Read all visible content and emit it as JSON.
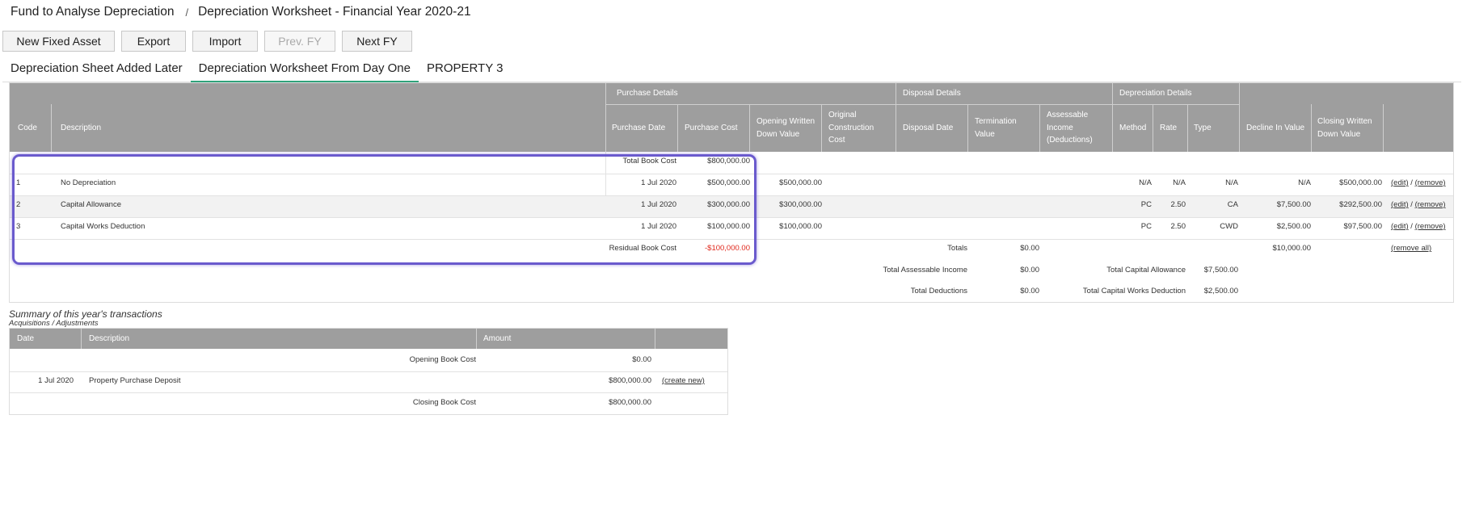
{
  "breadcrumb": {
    "parent": "Fund to Analyse Depreciation",
    "separator": "/",
    "current": "Depreciation Worksheet - Financial Year 2020-21"
  },
  "toolbar": {
    "new_fixed_asset": "New Fixed Asset",
    "export": "Export",
    "import": "Import",
    "prev_fy": "Prev. FY",
    "next_fy": "Next FY"
  },
  "tabs": [
    {
      "label": "Depreciation Sheet Added Later",
      "active": false
    },
    {
      "label": "Depreciation Worksheet From Day One",
      "active": true
    },
    {
      "label": "PROPERTY 3",
      "active": false
    }
  ],
  "table": {
    "groups": {
      "purchase": "Purchase Details",
      "disposal": "Disposal Details",
      "depreciation": "Depreciation Details"
    },
    "columns": {
      "code": "Code",
      "description": "Description",
      "purchase_date": "Purchase Date",
      "purchase_cost": "Purchase Cost",
      "opening_wdv": [
        "Opening Written",
        "Down Value"
      ],
      "original_cost": [
        "Original",
        "Construction",
        "Cost"
      ],
      "disposal_date": "Disposal Date",
      "termination_value": [
        "Termination",
        "Value"
      ],
      "assessable_income": [
        "Assessable",
        "Income",
        "(Deductions)"
      ],
      "method": "Method",
      "rate": "Rate",
      "type": "Type",
      "decline": "Decline In Value",
      "closing_wdv": [
        "Closing Written",
        "Down Value"
      ]
    },
    "total_book_cost_label": "Total Book Cost",
    "total_book_cost": "$800,000.00",
    "rows": [
      {
        "code": "1",
        "description": "No Depreciation",
        "purchase_date": "1 Jul 2020",
        "purchase_cost": "$500,000.00",
        "opening_wdv": "$500,000.00",
        "method": "N/A",
        "rate": "N/A",
        "type": "N/A",
        "decline": "N/A",
        "closing_wdv": "$500,000.00",
        "edit": "(edit)",
        "slash": "/",
        "remove": "(remove)"
      },
      {
        "code": "2",
        "description": "Capital Allowance",
        "purchase_date": "1 Jul 2020",
        "purchase_cost": "$300,000.00",
        "opening_wdv": "$300,000.00",
        "method": "PC",
        "rate": "2.50",
        "type": "CA",
        "decline": "$7,500.00",
        "closing_wdv": "$292,500.00",
        "edit": "(edit)",
        "slash": "/",
        "remove": "(remove)"
      },
      {
        "code": "3",
        "description": "Capital Works Deduction",
        "purchase_date": "1 Jul 2020",
        "purchase_cost": "$100,000.00",
        "opening_wdv": "$100,000.00",
        "method": "PC",
        "rate": "2.50",
        "type": "CWD",
        "decline": "$2,500.00",
        "closing_wdv": "$97,500.00",
        "edit": "(edit)",
        "slash": "/",
        "remove": "(remove)"
      }
    ],
    "residual_label": "Residual Book Cost",
    "residual_value": "-$100,000.00",
    "totals_label": "Totals",
    "totals_termination": "$0.00",
    "totals_decline": "$10,000.00",
    "remove_all": "(remove all)",
    "total_assessable_label": "Total Assessable Income",
    "total_assessable": "$0.00",
    "total_capital_allowance_label": "Total Capital Allowance",
    "total_capital_allowance": "$7,500.00",
    "total_deductions_label": "Total Deductions",
    "total_deductions": "$0.00",
    "total_cwd_label": "Total Capital Works Deduction",
    "total_cwd": "$2,500.00"
  },
  "summary": {
    "title": "Summary of this year's transactions",
    "subtitle": "Acquisitions / Adjustments",
    "columns": {
      "date": "Date",
      "description": "Description",
      "amount": "Amount"
    },
    "opening_label": "Opening Book Cost",
    "opening_value": "$0.00",
    "row": {
      "date": "1 Jul 2020",
      "description": "Property Purchase Deposit",
      "amount": "$800,000.00",
      "action": "(create new)"
    },
    "closing_label": "Closing Book Cost",
    "closing_value": "$800,000.00"
  },
  "colors": {
    "header_bg": "#9e9e9e",
    "tab_active": "#2fa37b",
    "negative": "#e0271b",
    "highlight": "#6a5acd"
  }
}
